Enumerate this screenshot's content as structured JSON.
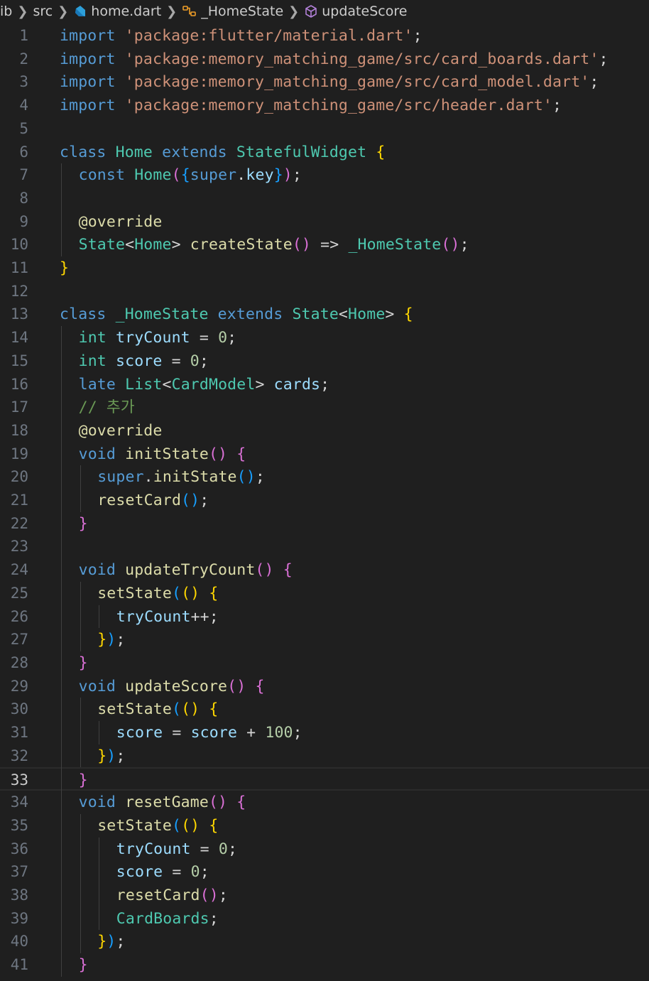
{
  "breadcrumb": {
    "items": [
      {
        "label": "ib",
        "icon": ""
      },
      {
        "label": "src",
        "icon": ""
      },
      {
        "label": "home.dart",
        "icon": "dart-file-icon"
      },
      {
        "label": "_HomeState",
        "icon": "class-icon"
      },
      {
        "label": "updateScore",
        "icon": "method-icon"
      }
    ],
    "separator": "❯"
  },
  "editor": {
    "current_line": 33,
    "colors": {
      "background": "#1f1f1f",
      "keyword": "#569cd6",
      "control": "#c586c0",
      "string": "#ce9178",
      "type": "#4ec9b0",
      "function": "#dcdcaa",
      "variable": "#9cdcfe",
      "number": "#b5cea8",
      "comment": "#6a9955"
    },
    "lines": [
      {
        "n": 1,
        "indent": 0,
        "tokens": [
          [
            "kw",
            "import"
          ],
          [
            "pun",
            " "
          ],
          [
            "str",
            "'package:flutter/material.dart'"
          ],
          [
            "pun",
            ";"
          ]
        ]
      },
      {
        "n": 2,
        "indent": 0,
        "tokens": [
          [
            "kw",
            "import"
          ],
          [
            "pun",
            " "
          ],
          [
            "str",
            "'package:memory_matching_game/src/card_boards.dart'"
          ],
          [
            "pun",
            ";"
          ]
        ]
      },
      {
        "n": 3,
        "indent": 0,
        "tokens": [
          [
            "kw",
            "import"
          ],
          [
            "pun",
            " "
          ],
          [
            "str",
            "'package:memory_matching_game/src/card_model.dart'"
          ],
          [
            "pun",
            ";"
          ]
        ]
      },
      {
        "n": 4,
        "indent": 0,
        "tokens": [
          [
            "kw",
            "import"
          ],
          [
            "pun",
            " "
          ],
          [
            "str",
            "'package:memory_matching_game/src/header.dart'"
          ],
          [
            "pun",
            ";"
          ]
        ]
      },
      {
        "n": 5,
        "indent": 0,
        "tokens": []
      },
      {
        "n": 6,
        "indent": 0,
        "tokens": [
          [
            "kw",
            "class"
          ],
          [
            "pun",
            " "
          ],
          [
            "cls",
            "Home"
          ],
          [
            "pun",
            " "
          ],
          [
            "kw",
            "extends"
          ],
          [
            "pun",
            " "
          ],
          [
            "cls",
            "StatefulWidget"
          ],
          [
            "pun",
            " "
          ],
          [
            "b1",
            "{"
          ]
        ]
      },
      {
        "n": 7,
        "indent": 1,
        "tokens": [
          [
            "kw",
            "const"
          ],
          [
            "pun",
            " "
          ],
          [
            "cls",
            "Home"
          ],
          [
            "b2",
            "("
          ],
          [
            "b3",
            "{"
          ],
          [
            "kw",
            "super"
          ],
          [
            "pun",
            "."
          ],
          [
            "var",
            "key"
          ],
          [
            "b3",
            "}"
          ],
          [
            "b2",
            ")"
          ],
          [
            "pun",
            ";"
          ]
        ]
      },
      {
        "n": 8,
        "indent": 1,
        "tokens": []
      },
      {
        "n": 9,
        "indent": 1,
        "tokens": [
          [
            "ann",
            "@override"
          ]
        ]
      },
      {
        "n": 10,
        "indent": 1,
        "tokens": [
          [
            "cls",
            "State"
          ],
          [
            "pun",
            "<"
          ],
          [
            "cls",
            "Home"
          ],
          [
            "pun",
            "> "
          ],
          [
            "fn",
            "createState"
          ],
          [
            "b2",
            "()"
          ],
          [
            "pun",
            " "
          ],
          [
            "op",
            "=>"
          ],
          [
            "pun",
            " "
          ],
          [
            "cls",
            "_HomeState"
          ],
          [
            "b2",
            "()"
          ],
          [
            "pun",
            ";"
          ]
        ]
      },
      {
        "n": 11,
        "indent": 0,
        "tokens": [
          [
            "b1",
            "}"
          ]
        ]
      },
      {
        "n": 12,
        "indent": 0,
        "tokens": []
      },
      {
        "n": 13,
        "indent": 0,
        "tokens": [
          [
            "kw",
            "class"
          ],
          [
            "pun",
            " "
          ],
          [
            "cls",
            "_HomeState"
          ],
          [
            "pun",
            " "
          ],
          [
            "kw",
            "extends"
          ],
          [
            "pun",
            " "
          ],
          [
            "cls",
            "State"
          ],
          [
            "pun",
            "<"
          ],
          [
            "cls",
            "Home"
          ],
          [
            "pun",
            "> "
          ],
          [
            "b1",
            "{"
          ]
        ]
      },
      {
        "n": 14,
        "indent": 1,
        "tokens": [
          [
            "cls",
            "int"
          ],
          [
            "pun",
            " "
          ],
          [
            "var",
            "tryCount"
          ],
          [
            "pun",
            " = "
          ],
          [
            "num",
            "0"
          ],
          [
            "pun",
            ";"
          ]
        ]
      },
      {
        "n": 15,
        "indent": 1,
        "tokens": [
          [
            "cls",
            "int"
          ],
          [
            "pun",
            " "
          ],
          [
            "var",
            "score"
          ],
          [
            "pun",
            " = "
          ],
          [
            "num",
            "0"
          ],
          [
            "pun",
            ";"
          ]
        ]
      },
      {
        "n": 16,
        "indent": 1,
        "tokens": [
          [
            "kw",
            "late"
          ],
          [
            "pun",
            " "
          ],
          [
            "cls",
            "List"
          ],
          [
            "pun",
            "<"
          ],
          [
            "cls",
            "CardModel"
          ],
          [
            "pun",
            "> "
          ],
          [
            "var",
            "cards"
          ],
          [
            "pun",
            ";"
          ]
        ]
      },
      {
        "n": 17,
        "indent": 1,
        "tokens": [
          [
            "cmt",
            "// 추가"
          ]
        ]
      },
      {
        "n": 18,
        "indent": 1,
        "tokens": [
          [
            "ann",
            "@override"
          ]
        ]
      },
      {
        "n": 19,
        "indent": 1,
        "tokens": [
          [
            "kw",
            "void"
          ],
          [
            "pun",
            " "
          ],
          [
            "fn",
            "initState"
          ],
          [
            "b2",
            "()"
          ],
          [
            "pun",
            " "
          ],
          [
            "b2",
            "{"
          ]
        ]
      },
      {
        "n": 20,
        "indent": 2,
        "tokens": [
          [
            "kw",
            "super"
          ],
          [
            "pun",
            "."
          ],
          [
            "fn",
            "initState"
          ],
          [
            "b3",
            "()"
          ],
          [
            "pun",
            ";"
          ]
        ]
      },
      {
        "n": 21,
        "indent": 2,
        "tokens": [
          [
            "fn",
            "resetCard"
          ],
          [
            "b3",
            "()"
          ],
          [
            "pun",
            ";"
          ]
        ]
      },
      {
        "n": 22,
        "indent": 1,
        "tokens": [
          [
            "b2",
            "}"
          ]
        ]
      },
      {
        "n": 23,
        "indent": 1,
        "tokens": []
      },
      {
        "n": 24,
        "indent": 1,
        "tokens": [
          [
            "kw",
            "void"
          ],
          [
            "pun",
            " "
          ],
          [
            "fn",
            "updateTryCount"
          ],
          [
            "b2",
            "()"
          ],
          [
            "pun",
            " "
          ],
          [
            "b2",
            "{"
          ]
        ]
      },
      {
        "n": 25,
        "indent": 2,
        "tokens": [
          [
            "fn",
            "setState"
          ],
          [
            "b3",
            "("
          ],
          [
            "b1",
            "()"
          ],
          [
            "pun",
            " "
          ],
          [
            "b1",
            "{"
          ]
        ]
      },
      {
        "n": 26,
        "indent": 3,
        "tokens": [
          [
            "var",
            "tryCount"
          ],
          [
            "op",
            "++"
          ],
          [
            "pun",
            ";"
          ]
        ]
      },
      {
        "n": 27,
        "indent": 2,
        "tokens": [
          [
            "b1",
            "}"
          ],
          [
            "b3",
            ")"
          ],
          [
            "pun",
            ";"
          ]
        ]
      },
      {
        "n": 28,
        "indent": 1,
        "tokens": [
          [
            "b2",
            "}"
          ]
        ]
      },
      {
        "n": 29,
        "indent": 1,
        "tokens": [
          [
            "kw",
            "void"
          ],
          [
            "pun",
            " "
          ],
          [
            "fn",
            "updateScore"
          ],
          [
            "b2",
            "()"
          ],
          [
            "pun",
            " "
          ],
          [
            "b2",
            "{"
          ]
        ]
      },
      {
        "n": 30,
        "indent": 2,
        "tokens": [
          [
            "fn",
            "setState"
          ],
          [
            "b3",
            "("
          ],
          [
            "b1",
            "()"
          ],
          [
            "pun",
            " "
          ],
          [
            "b1",
            "{"
          ]
        ]
      },
      {
        "n": 31,
        "indent": 3,
        "tokens": [
          [
            "var",
            "score"
          ],
          [
            "pun",
            " = "
          ],
          [
            "var",
            "score"
          ],
          [
            "pun",
            " + "
          ],
          [
            "num",
            "100"
          ],
          [
            "pun",
            ";"
          ]
        ]
      },
      {
        "n": 32,
        "indent": 2,
        "tokens": [
          [
            "b1",
            "}"
          ],
          [
            "b3",
            ")"
          ],
          [
            "pun",
            ";"
          ]
        ]
      },
      {
        "n": 33,
        "indent": 1,
        "tokens": [
          [
            "b2",
            "}"
          ]
        ]
      },
      {
        "n": 34,
        "indent": 1,
        "tokens": [
          [
            "kw",
            "void"
          ],
          [
            "pun",
            " "
          ],
          [
            "fn",
            "resetGame"
          ],
          [
            "b2",
            "()"
          ],
          [
            "pun",
            " "
          ],
          [
            "b2",
            "{"
          ]
        ]
      },
      {
        "n": 35,
        "indent": 2,
        "tokens": [
          [
            "fn",
            "setState"
          ],
          [
            "b3",
            "("
          ],
          [
            "b1",
            "()"
          ],
          [
            "pun",
            " "
          ],
          [
            "b1",
            "{"
          ]
        ]
      },
      {
        "n": 36,
        "indent": 3,
        "tokens": [
          [
            "var",
            "tryCount"
          ],
          [
            "pun",
            " = "
          ],
          [
            "num",
            "0"
          ],
          [
            "pun",
            ";"
          ]
        ]
      },
      {
        "n": 37,
        "indent": 3,
        "tokens": [
          [
            "var",
            "score"
          ],
          [
            "pun",
            " = "
          ],
          [
            "num",
            "0"
          ],
          [
            "pun",
            ";"
          ]
        ]
      },
      {
        "n": 38,
        "indent": 3,
        "tokens": [
          [
            "fn",
            "resetCard"
          ],
          [
            "b2",
            "()"
          ],
          [
            "pun",
            ";"
          ]
        ]
      },
      {
        "n": 39,
        "indent": 3,
        "tokens": [
          [
            "cls",
            "CardBoards"
          ],
          [
            "pun",
            ";"
          ]
        ]
      },
      {
        "n": 40,
        "indent": 2,
        "tokens": [
          [
            "b1",
            "}"
          ],
          [
            "b3",
            ")"
          ],
          [
            "pun",
            ";"
          ]
        ]
      },
      {
        "n": 41,
        "indent": 1,
        "tokens": [
          [
            "b2",
            "}"
          ]
        ]
      }
    ]
  }
}
